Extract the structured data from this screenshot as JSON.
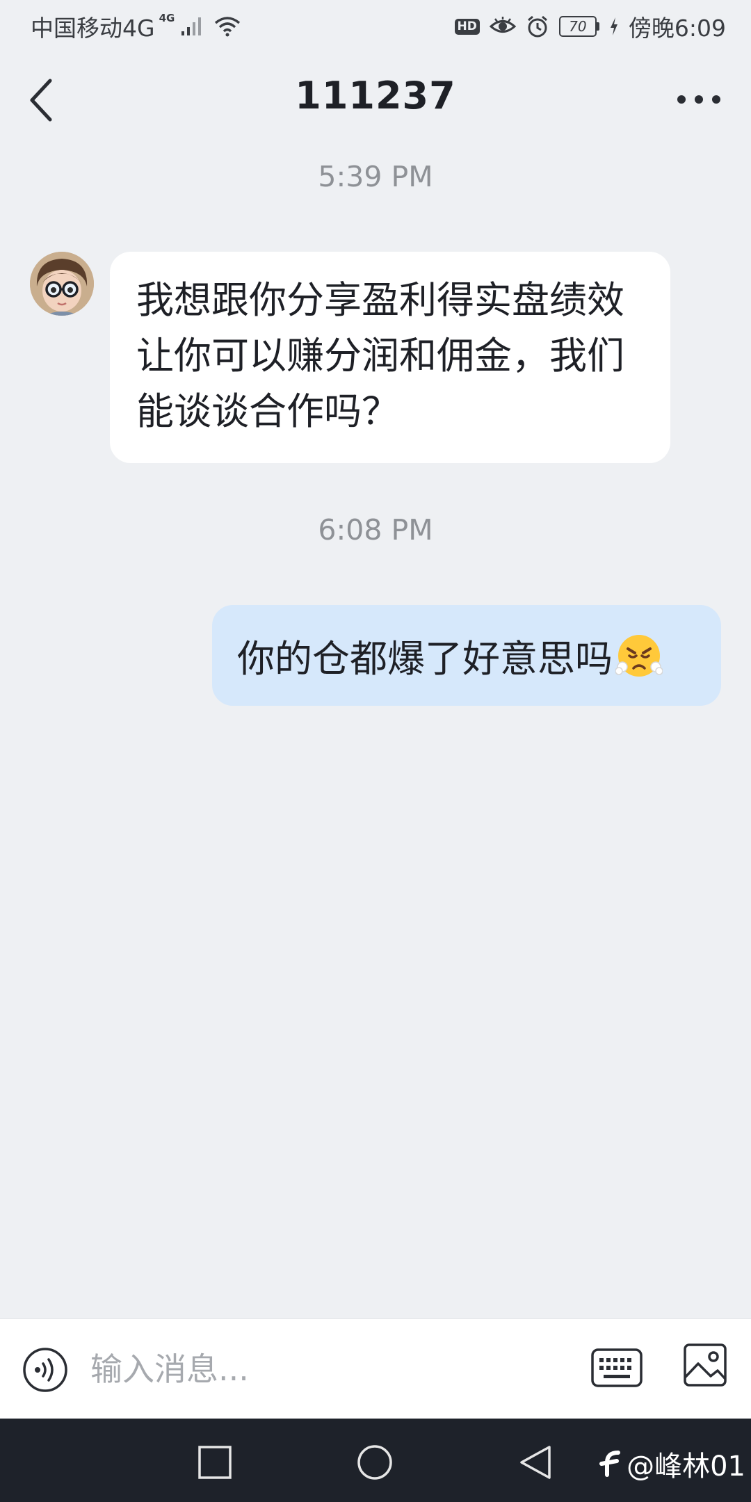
{
  "status_bar": {
    "carrier": "中国移动4G",
    "network_sup": "4G",
    "hd_badge": "HD",
    "battery": "70",
    "time": "傍晚6:09"
  },
  "header": {
    "title": "111237"
  },
  "messages": [
    {
      "timestamp": "5:39 PM",
      "direction": "incoming",
      "text": "我想跟你分享盈利得实盘绩效让你可以赚分润和佣金，我们能谈谈合作吗？"
    },
    {
      "timestamp": "6:08 PM",
      "direction": "outgoing",
      "text": "你的仓都爆了好意思吗",
      "emoji": "face-with-steam-from-nose"
    }
  ],
  "input": {
    "placeholder": "输入消息..."
  },
  "watermark": {
    "text": "@峰林01"
  },
  "colors": {
    "background": "#EEF0F3",
    "incoming_bubble": "#FFFFFF",
    "outgoing_bubble": "#D6E8FB",
    "timestamp": "#8E9196",
    "nav_bar": "#1E222A"
  }
}
